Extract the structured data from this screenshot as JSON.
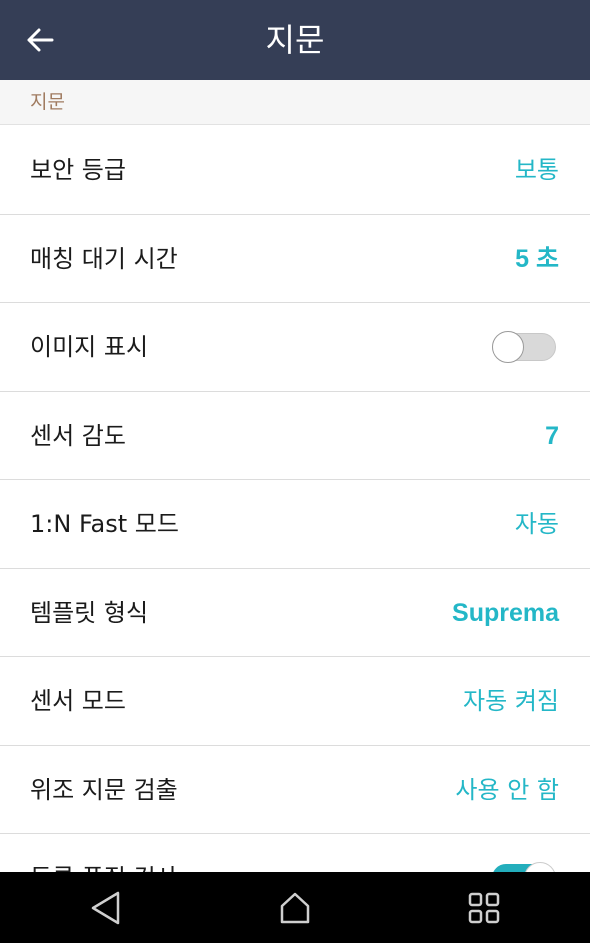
{
  "header": {
    "title": "지문",
    "back_icon": "arrow-left-icon"
  },
  "section": {
    "title": "지문"
  },
  "settings": [
    {
      "label": "보안 등급",
      "value": "보통"
    },
    {
      "label": "매칭 대기 시간",
      "value": "5 초"
    },
    {
      "label": "이미지 표시",
      "toggle": false
    },
    {
      "label": "센서 감도",
      "value": "7"
    },
    {
      "label": "1:N Fast 모드",
      "value": "자동"
    },
    {
      "label": "템플릿 형식",
      "value": "Suprema"
    },
    {
      "label": "센서 모드",
      "value": "자동 켜짐"
    },
    {
      "label": "위조 지문 검출",
      "value": "사용 안 함"
    },
    {
      "label": "등록 품질 검사",
      "toggle": true
    }
  ],
  "navigation": {
    "back_icon": "nav-back-icon",
    "home_icon": "nav-home-icon",
    "recents_icon": "nav-recents-icon"
  },
  "colors": {
    "appbar": "#353e56",
    "accent": "#24b7c7",
    "section_text": "#a07b60"
  }
}
